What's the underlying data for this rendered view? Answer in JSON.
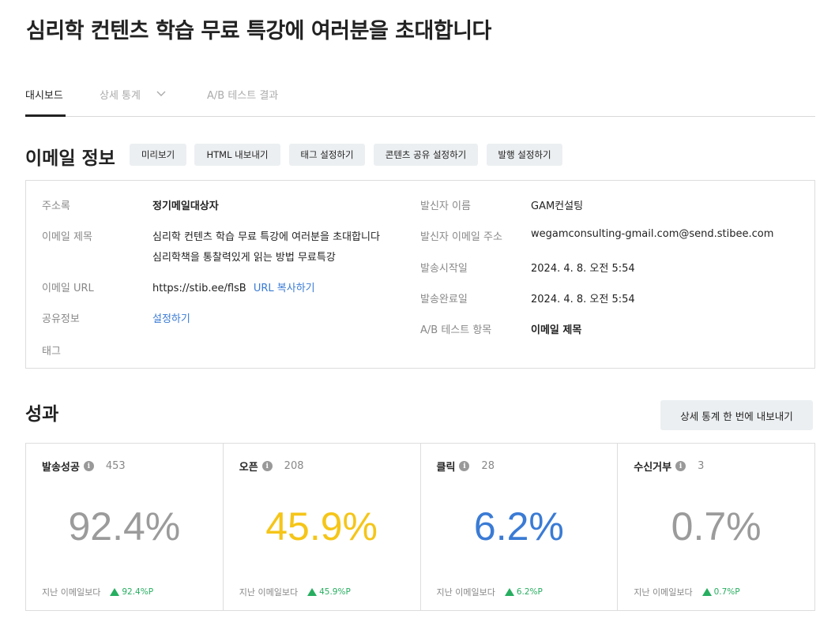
{
  "page": {
    "title": "심리학 컨텐츠 학습 무료 특강에 여러분을 초대합니다"
  },
  "tabs": [
    {
      "label": "대시보드"
    },
    {
      "label": "상세 통계"
    },
    {
      "label": "A/B 테스트 결과"
    }
  ],
  "email_info": {
    "heading": "이메일 정보",
    "buttons": {
      "preview": "미리보기",
      "html_export": "HTML 내보내기",
      "tag_settings": "태그 설정하기",
      "share_settings": "콘텐츠 공유 설정하기",
      "publish_settings": "발행 설정하기"
    },
    "address_book_label": "주소록",
    "address_book_value": "정기메일대상자",
    "subject_label": "이메일 제목",
    "subject_a": "심리학 컨텐츠 학습 무료 특강에 여러분을 초대합니다",
    "subject_b": "심리학책을 통찰력있게 읽는 방법 무료특강",
    "url_label": "이메일 URL",
    "url_value": "https://stib.ee/flsB",
    "url_copy": "URL 복사하기",
    "share_label": "공유정보",
    "share_link": "설정하기",
    "tag_label": "태그",
    "sender_name_label": "발신자 이름",
    "sender_name_value": "GAM컨설팅",
    "sender_email_label": "발신자 이메일 주소",
    "sender_email_value": "wegamconsulting-gmail.com@send.stibee.com",
    "send_start_label": "발송시작일",
    "send_start_value": "2024. 4. 8. 오전 5:54",
    "send_end_label": "발송완료일",
    "send_end_value": "2024. 4. 8. 오전 5:54",
    "ab_label": "A/B 테스트 항목",
    "ab_value": "이메일 제목"
  },
  "performance": {
    "heading": "성과",
    "export_button": "상세 통계 한 번에 내보내기",
    "compare_label": "지난 이메일보다",
    "stats": [
      {
        "label": "발송성공",
        "count": "453",
        "percent": "92.4%",
        "delta": "92.4%P",
        "color": "#9b9b9b"
      },
      {
        "label": "오픈",
        "count": "208",
        "percent": "45.9%",
        "delta": "45.9%P",
        "color": "#f5c518"
      },
      {
        "label": "클릭",
        "count": "28",
        "percent": "6.2%",
        "delta": "6.2%P",
        "color": "#3a7bd5"
      },
      {
        "label": "수신거부",
        "count": "3",
        "percent": "0.7%",
        "delta": "0.7%P",
        "color": "#9b9b9b"
      }
    ]
  },
  "icons": {
    "info": "info-icon",
    "chevron": "chevron-down-icon",
    "trend": "arrow-up-icon"
  },
  "colors": {
    "accent_link": "#3a7bd5",
    "trend_up": "#27ae60"
  }
}
